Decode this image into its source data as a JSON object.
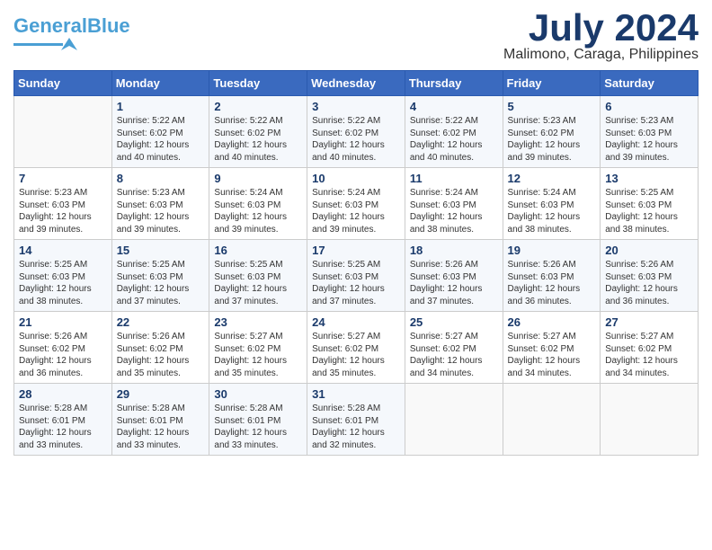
{
  "header": {
    "logo_line1": "General",
    "logo_line2": "Blue",
    "month": "July 2024",
    "location": "Malimono, Caraga, Philippines"
  },
  "weekdays": [
    "Sunday",
    "Monday",
    "Tuesday",
    "Wednesday",
    "Thursday",
    "Friday",
    "Saturday"
  ],
  "weeks": [
    [
      {
        "day": "",
        "info": ""
      },
      {
        "day": "1",
        "info": "Sunrise: 5:22 AM\nSunset: 6:02 PM\nDaylight: 12 hours\nand 40 minutes."
      },
      {
        "day": "2",
        "info": "Sunrise: 5:22 AM\nSunset: 6:02 PM\nDaylight: 12 hours\nand 40 minutes."
      },
      {
        "day": "3",
        "info": "Sunrise: 5:22 AM\nSunset: 6:02 PM\nDaylight: 12 hours\nand 40 minutes."
      },
      {
        "day": "4",
        "info": "Sunrise: 5:22 AM\nSunset: 6:02 PM\nDaylight: 12 hours\nand 40 minutes."
      },
      {
        "day": "5",
        "info": "Sunrise: 5:23 AM\nSunset: 6:02 PM\nDaylight: 12 hours\nand 39 minutes."
      },
      {
        "day": "6",
        "info": "Sunrise: 5:23 AM\nSunset: 6:03 PM\nDaylight: 12 hours\nand 39 minutes."
      }
    ],
    [
      {
        "day": "7",
        "info": "Sunrise: 5:23 AM\nSunset: 6:03 PM\nDaylight: 12 hours\nand 39 minutes."
      },
      {
        "day": "8",
        "info": "Sunrise: 5:23 AM\nSunset: 6:03 PM\nDaylight: 12 hours\nand 39 minutes."
      },
      {
        "day": "9",
        "info": "Sunrise: 5:24 AM\nSunset: 6:03 PM\nDaylight: 12 hours\nand 39 minutes."
      },
      {
        "day": "10",
        "info": "Sunrise: 5:24 AM\nSunset: 6:03 PM\nDaylight: 12 hours\nand 39 minutes."
      },
      {
        "day": "11",
        "info": "Sunrise: 5:24 AM\nSunset: 6:03 PM\nDaylight: 12 hours\nand 38 minutes."
      },
      {
        "day": "12",
        "info": "Sunrise: 5:24 AM\nSunset: 6:03 PM\nDaylight: 12 hours\nand 38 minutes."
      },
      {
        "day": "13",
        "info": "Sunrise: 5:25 AM\nSunset: 6:03 PM\nDaylight: 12 hours\nand 38 minutes."
      }
    ],
    [
      {
        "day": "14",
        "info": "Sunrise: 5:25 AM\nSunset: 6:03 PM\nDaylight: 12 hours\nand 38 minutes."
      },
      {
        "day": "15",
        "info": "Sunrise: 5:25 AM\nSunset: 6:03 PM\nDaylight: 12 hours\nand 37 minutes."
      },
      {
        "day": "16",
        "info": "Sunrise: 5:25 AM\nSunset: 6:03 PM\nDaylight: 12 hours\nand 37 minutes."
      },
      {
        "day": "17",
        "info": "Sunrise: 5:25 AM\nSunset: 6:03 PM\nDaylight: 12 hours\nand 37 minutes."
      },
      {
        "day": "18",
        "info": "Sunrise: 5:26 AM\nSunset: 6:03 PM\nDaylight: 12 hours\nand 37 minutes."
      },
      {
        "day": "19",
        "info": "Sunrise: 5:26 AM\nSunset: 6:03 PM\nDaylight: 12 hours\nand 36 minutes."
      },
      {
        "day": "20",
        "info": "Sunrise: 5:26 AM\nSunset: 6:03 PM\nDaylight: 12 hours\nand 36 minutes."
      }
    ],
    [
      {
        "day": "21",
        "info": "Sunrise: 5:26 AM\nSunset: 6:02 PM\nDaylight: 12 hours\nand 36 minutes."
      },
      {
        "day": "22",
        "info": "Sunrise: 5:26 AM\nSunset: 6:02 PM\nDaylight: 12 hours\nand 35 minutes."
      },
      {
        "day": "23",
        "info": "Sunrise: 5:27 AM\nSunset: 6:02 PM\nDaylight: 12 hours\nand 35 minutes."
      },
      {
        "day": "24",
        "info": "Sunrise: 5:27 AM\nSunset: 6:02 PM\nDaylight: 12 hours\nand 35 minutes."
      },
      {
        "day": "25",
        "info": "Sunrise: 5:27 AM\nSunset: 6:02 PM\nDaylight: 12 hours\nand 34 minutes."
      },
      {
        "day": "26",
        "info": "Sunrise: 5:27 AM\nSunset: 6:02 PM\nDaylight: 12 hours\nand 34 minutes."
      },
      {
        "day": "27",
        "info": "Sunrise: 5:27 AM\nSunset: 6:02 PM\nDaylight: 12 hours\nand 34 minutes."
      }
    ],
    [
      {
        "day": "28",
        "info": "Sunrise: 5:28 AM\nSunset: 6:01 PM\nDaylight: 12 hours\nand 33 minutes."
      },
      {
        "day": "29",
        "info": "Sunrise: 5:28 AM\nSunset: 6:01 PM\nDaylight: 12 hours\nand 33 minutes."
      },
      {
        "day": "30",
        "info": "Sunrise: 5:28 AM\nSunset: 6:01 PM\nDaylight: 12 hours\nand 33 minutes."
      },
      {
        "day": "31",
        "info": "Sunrise: 5:28 AM\nSunset: 6:01 PM\nDaylight: 12 hours\nand 32 minutes."
      },
      {
        "day": "",
        "info": ""
      },
      {
        "day": "",
        "info": ""
      },
      {
        "day": "",
        "info": ""
      }
    ]
  ]
}
